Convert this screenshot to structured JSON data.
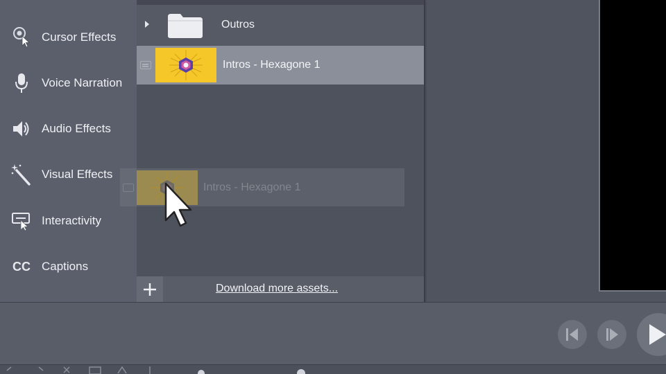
{
  "sidebar": {
    "items": [
      {
        "label": "Cursor Effects",
        "icon": "cursor-effects-icon"
      },
      {
        "label": "Voice Narration",
        "icon": "microphone-icon"
      },
      {
        "label": "Audio Effects",
        "icon": "speaker-icon"
      },
      {
        "label": "Visual Effects",
        "icon": "magic-wand-icon"
      },
      {
        "label": "Interactivity",
        "icon": "interactivity-icon"
      },
      {
        "label": "Captions",
        "icon": "cc-icon",
        "glyph": "CC"
      }
    ]
  },
  "library": {
    "folder": {
      "label": "Outros",
      "icon": "folder-icon"
    },
    "selected_asset": {
      "label": "Intros - Hexagone 1"
    },
    "drag_ghost": {
      "label": "Intros - Hexagone 1"
    },
    "footer": {
      "add_icon": "plus-icon",
      "download_label": "Download more assets..."
    }
  },
  "playback": {
    "buttons": [
      "step-back-icon",
      "step-forward-icon",
      "play-icon"
    ]
  },
  "colors": {
    "accent_thumb": "#f5c729",
    "selection": "#8a8f99",
    "panel": "#4e525d",
    "sidebar": "#5b5f6b"
  }
}
